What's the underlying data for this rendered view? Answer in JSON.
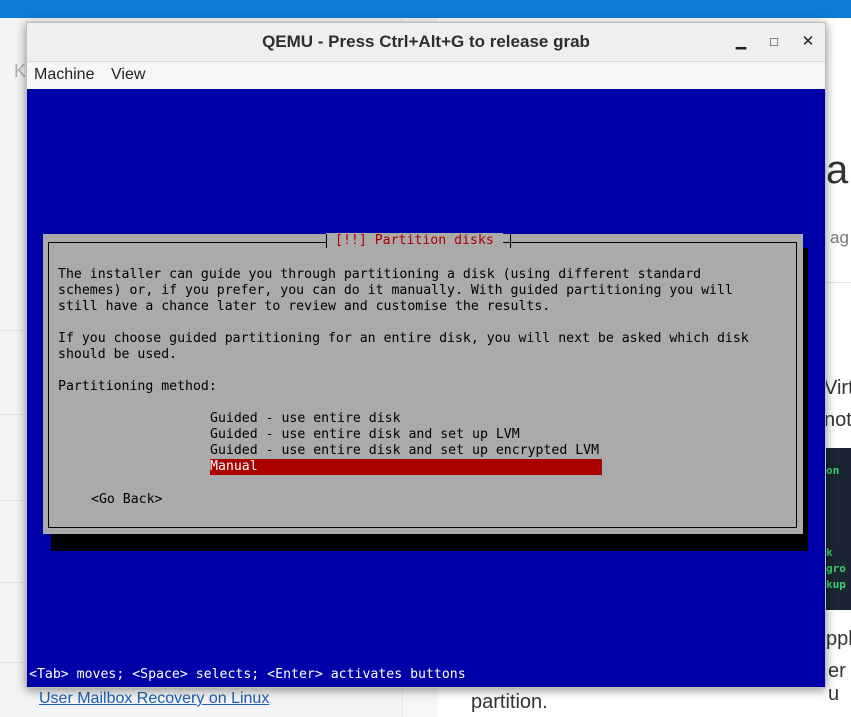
{
  "background": {
    "fragment_k": "K",
    "fragment_heading": "a",
    "fragment_ag": "ag",
    "fragment_virt": "Virt",
    "fragment_not": "not",
    "code_lines": [
      "on",
      "",
      "",
      "",
      "",
      "",
      "",
      "",
      "",
      "",
      "",
      "k",
      "gro",
      "kup"
    ],
    "fragment_appl": "ppl",
    "fragment_er_u": "er u",
    "link_text": "User Mailbox Recovery on Linux",
    "fragment_partition": "partition."
  },
  "window": {
    "title": "QEMU - Press Ctrl+Alt+G to release grab",
    "minimize_glyph": "▁",
    "maximize_glyph": "□",
    "close_glyph": "✕"
  },
  "menubar": {
    "items": [
      "Machine",
      "View"
    ]
  },
  "installer": {
    "title": "[!!] Partition disks",
    "description_lines": [
      "The installer can guide you through partitioning a disk (using different standard",
      "schemes) or, if you prefer, you can do it manually. With guided partitioning you will",
      "still have a chance later to review and customise the results."
    ],
    "second_paragraph_lines": [
      "If you choose guided partitioning for an entire disk, you will next be asked which disk",
      "should be used."
    ],
    "method_label": "Partitioning method:",
    "options": [
      "Guided - use entire disk",
      "Guided - use entire disk and set up LVM",
      "Guided - use entire disk and set up encrypted LVM",
      "Manual"
    ],
    "selected_option": "Manual",
    "go_back": "<Go Back>",
    "status_line": "<Tab> moves; <Space> selects; <Enter> activates buttons"
  },
  "colors": {
    "console_bg": "#0000a8",
    "dialog_bg": "#aaaaaa",
    "title_red": "#aa0000",
    "selection_red": "#aa0000"
  }
}
